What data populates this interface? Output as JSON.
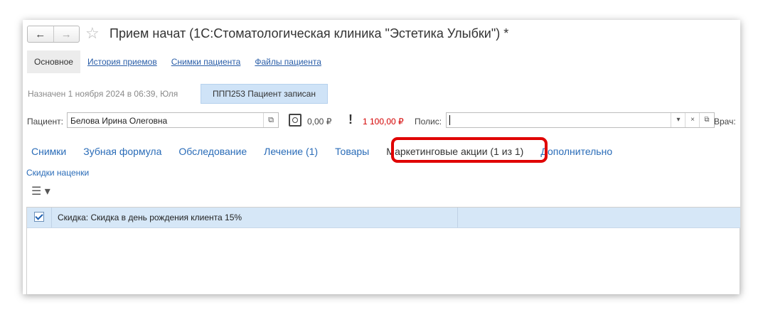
{
  "window": {
    "title": "Прием начат (1С:Стоматологическая клиника \"Эстетика Улыбки\") *",
    "nav_back": "←",
    "nav_forward": "→",
    "favorite": "☆"
  },
  "top_tabs": [
    {
      "label": "Основное",
      "active": true
    },
    {
      "label": "История приемов",
      "active": false
    },
    {
      "label": "Снимки пациента",
      "active": false
    },
    {
      "label": "Файлы пациента",
      "active": false
    }
  ],
  "appointment": {
    "assigned_text": "Назначен 1 ноября 2024  в 06:39, Юля",
    "status": "ППП253  Пациент записан"
  },
  "patient": {
    "label": "Пациент:",
    "value": "Белова Ирина Олеговна",
    "open_btn": "⧉",
    "balance": "0,00 ₽",
    "debt_mark": "!",
    "debt_amount": "1 100,00 ₽",
    "polis_label": "Полис:",
    "polis_value": "",
    "dropdown_btn": "▾",
    "clear_btn": "×",
    "doctor_label": "Врач:"
  },
  "section_tabs": [
    {
      "label": "Снимки",
      "active": false
    },
    {
      "label": "Зубная формула",
      "active": false
    },
    {
      "label": "Обследование",
      "active": false
    },
    {
      "label": "Лечение (1)",
      "active": false
    },
    {
      "label": "Товары",
      "active": false
    },
    {
      "label": "Маркетинговые акции (1 из 1)",
      "active": true
    },
    {
      "label": "Дополнительно",
      "active": false
    }
  ],
  "discounts": {
    "link": "Скидки наценки",
    "menu_icon": "☰ ▾",
    "rows": [
      {
        "checked": true,
        "text": "Скидка: Скидка в день рождения клиента 15%"
      }
    ]
  },
  "colors": {
    "accent": "#2a6cb8",
    "highlight": "#e00000",
    "debt": "#d40000"
  }
}
